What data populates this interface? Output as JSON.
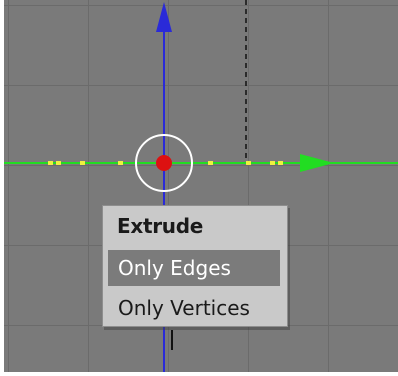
{
  "menu": {
    "title": "Extrude",
    "items": [
      {
        "label": "Only Edges",
        "highlighted": true
      },
      {
        "label": "Only Vertices",
        "highlighted": false
      }
    ]
  },
  "colors": {
    "viewport_bg": "#7a7a7a",
    "grid_line": "#6b6b6b",
    "x_axis": "#22dd22",
    "y_axis": "#2222dd",
    "center_point": "#dd1111",
    "rotate_circle": "#ffffff",
    "menu_bg": "#c9c9c9",
    "menu_highlight": "#7b7b7b"
  }
}
